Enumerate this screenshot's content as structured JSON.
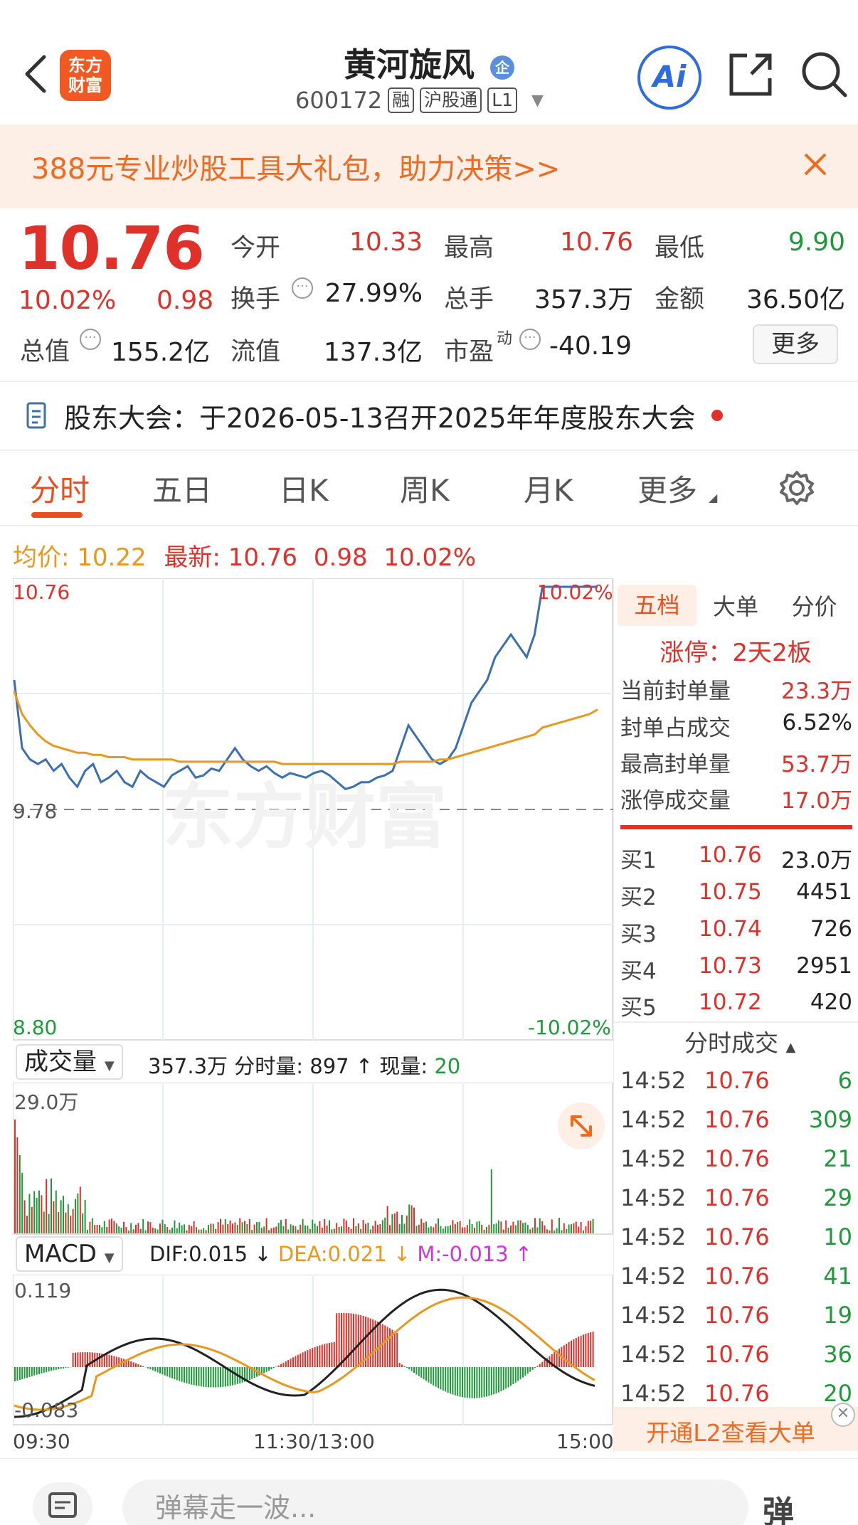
{
  "header": {
    "logo_line1": "东方",
    "logo_line2": "财富",
    "title": "黄河旋风",
    "title_badge": "企",
    "code": "600172",
    "tags": [
      "融",
      "沪股通",
      "L1"
    ],
    "ai_label": "Ai"
  },
  "banner": {
    "text": "388元专业炒股工具大礼包，助力决策>>"
  },
  "quote": {
    "price": "10.76",
    "change_pct": "10.02%",
    "change": "0.98",
    "open_label": "今开",
    "open": "10.33",
    "high_label": "最高",
    "high": "10.76",
    "low_label": "最低",
    "low": "9.90",
    "turnover_label": "换手",
    "turnover": "27.99%",
    "volume_label": "总手",
    "volume": "357.3万",
    "amount_label": "金额",
    "amount": "36.50亿",
    "mktcap_label": "总值",
    "mktcap": "155.2亿",
    "float_label": "流值",
    "float": "137.3亿",
    "pe_label": "市盈",
    "pe_sup": "动",
    "pe": "-40.19",
    "more_button": "更多"
  },
  "notice": {
    "text": "股东大会：于2026-05-13召开2025年年度股东大会"
  },
  "tabs": [
    "分时",
    "五日",
    "日K",
    "周K",
    "月K",
    "更多"
  ],
  "chart_info": {
    "avg_label": "均价:",
    "avg": "10.22",
    "latest_label": "最新:",
    "latest": "10.76",
    "change": "0.98",
    "change_pct": "10.02%"
  },
  "chart_labels": {
    "y_top": "10.76",
    "y_mid": "9.78",
    "y_bot": "8.80",
    "pct_top": "10.02%",
    "pct_bot": "-10.02%",
    "watermark": "东方财富",
    "x_start": "09:30",
    "x_mid": "11:30/13:00",
    "x_end": "15:00"
  },
  "chart_data": {
    "type": "line",
    "title": "",
    "xlabel": "",
    "ylabel": "",
    "ylim": [
      8.8,
      10.76
    ],
    "prev_close": 9.78,
    "series": [
      {
        "name": "",
        "color": "#3a6fb0",
        "values": [
          10.35,
          10.05,
          10.0,
          9.98,
          10.0,
          9.95,
          9.98,
          9.92,
          9.88,
          9.95,
          9.98,
          9.9,
          9.92,
          9.95,
          9.9,
          9.88,
          9.95,
          9.92,
          9.9,
          9.88,
          9.93,
          9.95,
          9.97,
          9.92,
          9.93,
          9.96,
          9.95,
          10.0,
          10.05,
          10.0,
          9.97,
          9.95,
          9.97,
          9.94,
          9.92,
          9.94,
          9.93,
          9.92,
          9.94,
          9.95,
          9.93,
          9.9,
          9.87,
          9.88,
          9.9,
          9.9,
          9.92,
          9.93,
          9.95,
          10.05,
          10.15,
          10.1,
          10.05,
          10.0,
          9.98,
          10.0,
          10.05,
          10.15,
          10.25,
          10.3,
          10.35,
          10.45,
          10.5,
          10.55,
          10.5,
          10.45,
          10.55,
          10.76,
          10.76,
          10.76,
          10.76,
          10.76,
          10.76,
          10.76,
          10.76
        ]
      },
      {
        "name": "",
        "color": "#e8981e",
        "values": [
          10.3,
          10.2,
          10.15,
          10.11,
          10.08,
          10.06,
          10.05,
          10.04,
          10.03,
          10.03,
          10.02,
          10.02,
          10.01,
          10.01,
          10.01,
          10.0,
          10.0,
          10.0,
          10.0,
          10.0,
          10.0,
          9.99,
          9.99,
          9.99,
          9.99,
          9.99,
          9.99,
          9.99,
          9.99,
          9.99,
          9.99,
          9.99,
          9.99,
          9.99,
          9.98,
          9.98,
          9.98,
          9.98,
          9.98,
          9.98,
          9.98,
          9.98,
          9.98,
          9.98,
          9.98,
          9.98,
          9.98,
          9.98,
          9.98,
          9.99,
          9.99,
          9.99,
          9.99,
          9.99,
          10.0,
          10.0,
          10.01,
          10.02,
          10.03,
          10.04,
          10.05,
          10.06,
          10.07,
          10.08,
          10.09,
          10.1,
          10.11,
          10.14,
          10.15,
          10.16,
          10.17,
          10.18,
          10.19,
          10.2,
          10.22
        ]
      }
    ]
  },
  "right_panel": {
    "tabs": [
      "五档",
      "大单",
      "分价"
    ],
    "limit_title": "涨停：2天2板",
    "stats": [
      {
        "label": "当前封单量",
        "value": "23.3万"
      },
      {
        "label": "封单占成交",
        "value": "6.52%"
      },
      {
        "label": "最高封单量",
        "value": "53.7万"
      },
      {
        "label": "涨停成交量",
        "value": "17.0万"
      }
    ],
    "bids": [
      {
        "label": "买1",
        "price": "10.76",
        "vol": "23.0万"
      },
      {
        "label": "买2",
        "price": "10.75",
        "vol": "4451"
      },
      {
        "label": "买3",
        "price": "10.74",
        "vol": "726"
      },
      {
        "label": "买4",
        "price": "10.73",
        "vol": "2951"
      },
      {
        "label": "买5",
        "price": "10.72",
        "vol": "420"
      }
    ],
    "trades_title": "分时成交",
    "trades": [
      {
        "time": "14:52",
        "price": "10.76",
        "vol": "6"
      },
      {
        "time": "14:52",
        "price": "10.76",
        "vol": "309"
      },
      {
        "time": "14:52",
        "price": "10.76",
        "vol": "21"
      },
      {
        "time": "14:52",
        "price": "10.76",
        "vol": "29"
      },
      {
        "time": "14:52",
        "price": "10.76",
        "vol": "10"
      },
      {
        "time": "14:52",
        "price": "10.76",
        "vol": "41"
      },
      {
        "time": "14:52",
        "price": "10.76",
        "vol": "19"
      },
      {
        "time": "14:52",
        "price": "10.76",
        "vol": "36"
      },
      {
        "time": "14:52",
        "price": "10.76",
        "vol": "20"
      }
    ],
    "l2_button": "开通L2查看大单"
  },
  "volume": {
    "dropdown": "成交量",
    "total": "357.3万",
    "part_label": "分时量:",
    "part_value": "897",
    "now_label": "现量:",
    "now_value": "20",
    "ymax": "29.0万"
  },
  "macd": {
    "dropdown": "MACD",
    "dif": "DIF:0.015",
    "dea": "DEA:0.021",
    "m": "M:-0.013",
    "ymax": "0.119",
    "ymin": "-0.083"
  },
  "bottom": {
    "placeholder": "弹幕走一波...",
    "right_label": "弹"
  }
}
